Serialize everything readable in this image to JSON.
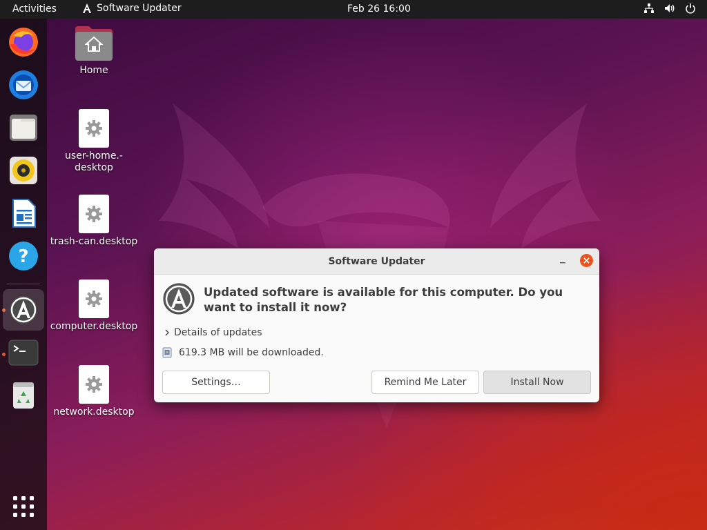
{
  "topbar": {
    "activities_label": "Activities",
    "app_name": "Software Updater",
    "clock": "Feb 26  16:00",
    "tray_icons": [
      "network-icon",
      "volume-icon",
      "power-icon"
    ]
  },
  "dock": {
    "items": [
      {
        "name": "firefox-icon",
        "running": false
      },
      {
        "name": "thunderbird-icon",
        "running": false
      },
      {
        "name": "files-icon",
        "running": false
      },
      {
        "name": "rhythmbox-icon",
        "running": false
      },
      {
        "name": "libreoffice-writer-icon",
        "running": false
      },
      {
        "name": "help-icon",
        "running": false
      },
      {
        "name": "software-updater-icon",
        "running": true
      },
      {
        "name": "terminal-icon",
        "running": true
      },
      {
        "name": "trash-icon",
        "running": false
      }
    ],
    "show_apps_icon": "app-grid-icon"
  },
  "desktop": {
    "icons": [
      {
        "label": "Home"
      },
      {
        "label": "user-home.-desktop"
      },
      {
        "label": "trash-can.desktop"
      },
      {
        "label": "computer.desktop"
      },
      {
        "label": "network.desktop"
      }
    ]
  },
  "dialog": {
    "title": "Software Updater",
    "headline": "Updated software is available for this computer. Do you want to install it now?",
    "details_label": "Details of updates",
    "download_text": "619.3 MB will be downloaded.",
    "buttons": {
      "settings": "Settings…",
      "remind": "Remind Me Later",
      "install": "Install Now"
    }
  },
  "colors": {
    "accent": "#e95420",
    "topbar": "#1d1d1d"
  }
}
